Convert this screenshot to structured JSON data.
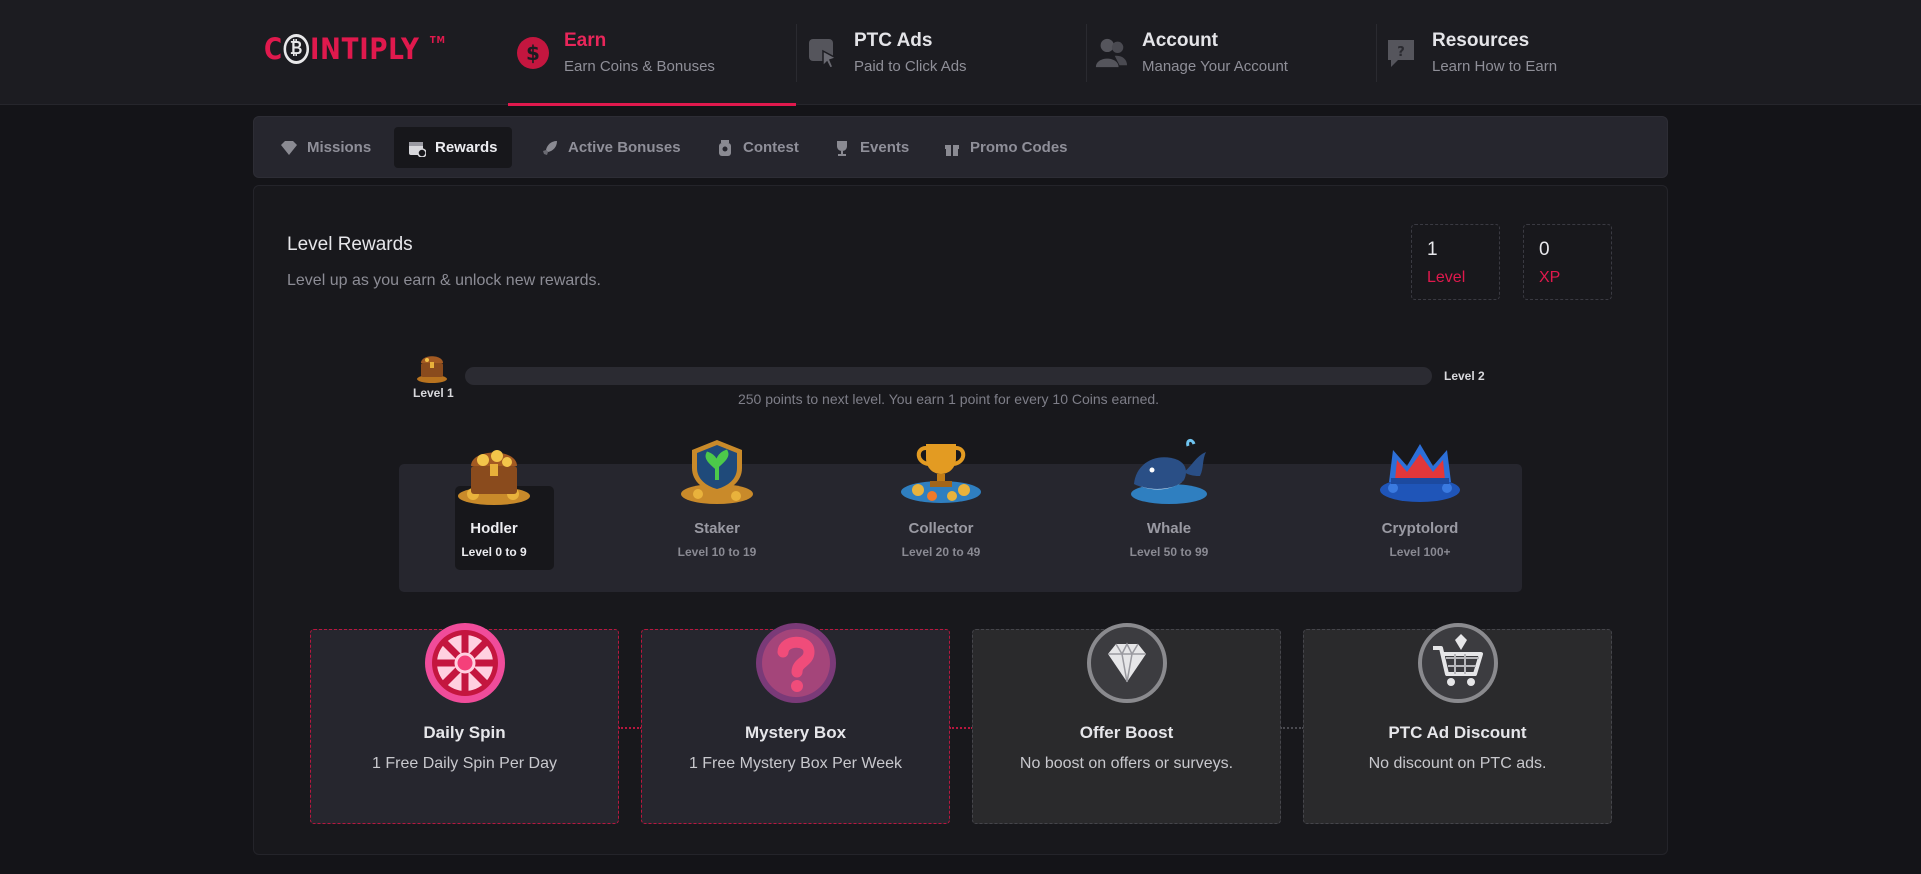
{
  "logo": {
    "prefix": "C",
    "suffix": "INTIPLY",
    "tm": "TM"
  },
  "nav": [
    {
      "title": "Earn",
      "subtitle": "Earn Coins & Bonuses",
      "icon": "dollar-icon"
    },
    {
      "title": "PTC Ads",
      "subtitle": "Paid to Click Ads",
      "icon": "pointer-icon"
    },
    {
      "title": "Account",
      "subtitle": "Manage Your Account",
      "icon": "users-icon"
    },
    {
      "title": "Resources",
      "subtitle": "Learn How to Earn",
      "icon": "help-bubble-icon"
    }
  ],
  "subtabs": [
    {
      "label": "Missions",
      "icon": "diamond-icon"
    },
    {
      "label": "Rewards",
      "icon": "calendar-icon"
    },
    {
      "label": "Active Bonuses",
      "icon": "rocket-icon"
    },
    {
      "label": "Contest",
      "icon": "jar-icon"
    },
    {
      "label": "Events",
      "icon": "trophy-icon"
    },
    {
      "label": "Promo Codes",
      "icon": "gift-icon"
    }
  ],
  "rewards": {
    "title": "Level Rewards",
    "subtitle": "Level up as you earn & unlock new rewards.",
    "level": {
      "value": "1",
      "label": "Level"
    },
    "xp": {
      "value": "0",
      "label": "XP"
    }
  },
  "progress": {
    "from_label": "Level 1",
    "to_label": "Level 2",
    "fraction": 0,
    "text": "250 points to next level. You earn 1 point for every 10 Coins earned."
  },
  "tiers": [
    {
      "name": "Hodler",
      "range": "Level 0 to 9",
      "icon": "treasure-chest-icon"
    },
    {
      "name": "Staker",
      "range": "Level 10 to 19",
      "icon": "shield-plant-icon"
    },
    {
      "name": "Collector",
      "range": "Level 20 to 49",
      "icon": "trophy-coins-icon"
    },
    {
      "name": "Whale",
      "range": "Level 50 to 99",
      "icon": "whale-icon"
    },
    {
      "name": "Cryptolord",
      "range": "Level 100+",
      "icon": "crown-icon"
    }
  ],
  "reward_cards": [
    {
      "title": "Daily Spin",
      "desc": "1 Free Daily Spin Per Day",
      "icon": "spin-wheel-icon"
    },
    {
      "title": "Mystery Box",
      "desc": "1 Free Mystery Box Per Week",
      "icon": "question-mark-icon"
    },
    {
      "title": "Offer Boost",
      "desc": "No boost on offers or surveys.",
      "icon": "diamond-icon"
    },
    {
      "title": "PTC Ad Discount",
      "desc": "No discount on PTC ads.",
      "icon": "shopping-cart-icon"
    }
  ],
  "colors": {
    "accent": "#e0194d",
    "background": "#141418",
    "panel": "#26262e"
  }
}
